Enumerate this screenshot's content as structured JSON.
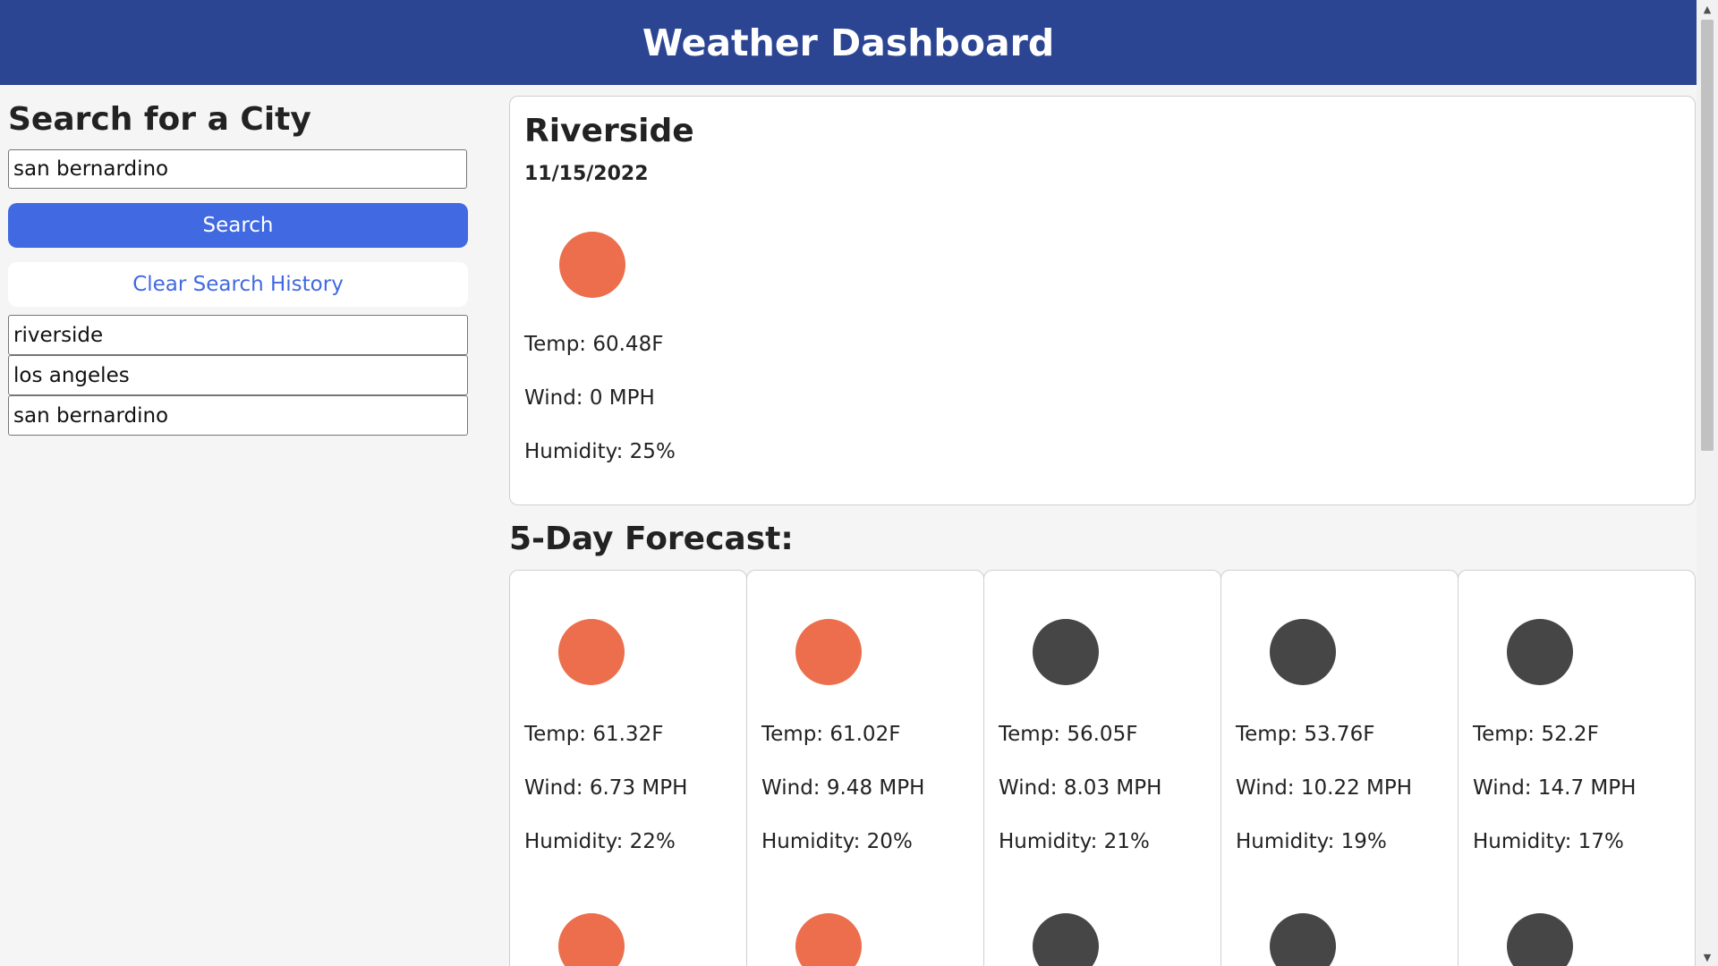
{
  "header": {
    "title": "Weather Dashboard"
  },
  "sidebar": {
    "heading": "Search for a City",
    "search_value": "san bernardino",
    "search_button": "Search",
    "clear_button": "Clear Search History",
    "history": [
      "riverside",
      "los angeles",
      "san bernardino"
    ]
  },
  "current": {
    "city": "Riverside",
    "date": "11/15/2022",
    "icon": "sun-icon",
    "icon_color": "#ec6e4c",
    "temp": "Temp: 60.48F",
    "wind": "Wind: 0 MPH",
    "humidity": "Humidity: 25%"
  },
  "forecast": {
    "title": "5-Day Forecast:",
    "days": [
      {
        "icon": "sun-icon",
        "icon_color": "#ec6e4c",
        "temp": "Temp: 61.32F",
        "wind": "Wind: 6.73 MPH",
        "humidity": "Humidity: 22%"
      },
      {
        "icon": "sun-icon",
        "icon_color": "#ec6e4c",
        "temp": "Temp: 61.02F",
        "wind": "Wind: 9.48 MPH",
        "humidity": "Humidity: 20%"
      },
      {
        "icon": "night-icon",
        "icon_color": "#464646",
        "temp": "Temp: 56.05F",
        "wind": "Wind: 8.03 MPH",
        "humidity": "Humidity: 21%"
      },
      {
        "icon": "night-icon",
        "icon_color": "#464646",
        "temp": "Temp: 53.76F",
        "wind": "Wind: 10.22 MPH",
        "humidity": "Humidity: 19%"
      },
      {
        "icon": "night-icon",
        "icon_color": "#464646",
        "temp": "Temp: 52.2F",
        "wind": "Wind: 14.7 MPH",
        "humidity": "Humidity: 17%"
      }
    ]
  },
  "colors": {
    "header_bg": "#2b4593",
    "accent": "#4169e1"
  }
}
